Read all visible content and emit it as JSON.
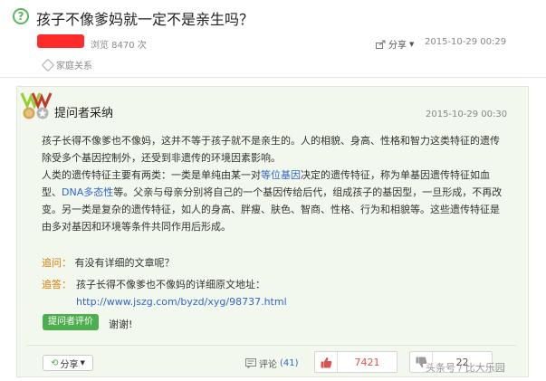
{
  "question": {
    "icon": "question-circle-icon",
    "title": "孩子不像爹妈就一定不是亲生吗？",
    "views": "浏览 8470 次",
    "share_label": "分享",
    "date": "2015-10-29 00:29",
    "tag": "家庭关系"
  },
  "answer": {
    "badge_title": "提问者采纳",
    "date": "2015-10-29 00:30",
    "para1": "孩子长得不像爹也不像妈，这并不等于孩子就不是亲生的。人的相貌、身高、性格和智力这类特征的遗传除受多个基因控制外，还受到非遗传的环境因素影响。",
    "para2_pre": "人类的遗传特征主要有两类：一类是单纯由某一对",
    "para2_link1": "等位基因",
    "para2_mid": "决定的遗传特征，称为单基因遗传特征如血型、",
    "para2_link2": "DNA多态性",
    "para2_post": "等。父亲与母亲分别将自己的一个基因传给后代，组成孩子的基因型，一旦形成，不再改变。另一类是复杂的遗传特征，如人的身高、胖瘦、肤色、智商、性格、行为和相貌等。这些遗传特征是由多对基因和环境等条件共同作用后形成。",
    "follow_q_label": "追问：",
    "follow_q_text": "有没有详细的文章呢？",
    "follow_a_label": "追答：",
    "follow_a_text": "孩子长得不像爹也不像妈的详细原文地址：",
    "follow_a_url": "http://www.jszg.com/byzd/xyg/98737.html",
    "eval_button": "提问者评价",
    "thanks": "谢谢!",
    "share_label": "分享",
    "comment_label": "评论",
    "comment_count": "(41)",
    "like_count": "7421",
    "dislike_count": "22"
  },
  "watermark": "头条号 / 比大乐园",
  "colors": {
    "accent_green": "#4cae4c",
    "link_blue": "#3366cc",
    "label_orange": "#e07a00",
    "like_red": "#d9534f",
    "redaction": "#ff2a2a",
    "panel_bg": "#f2f8ee"
  }
}
